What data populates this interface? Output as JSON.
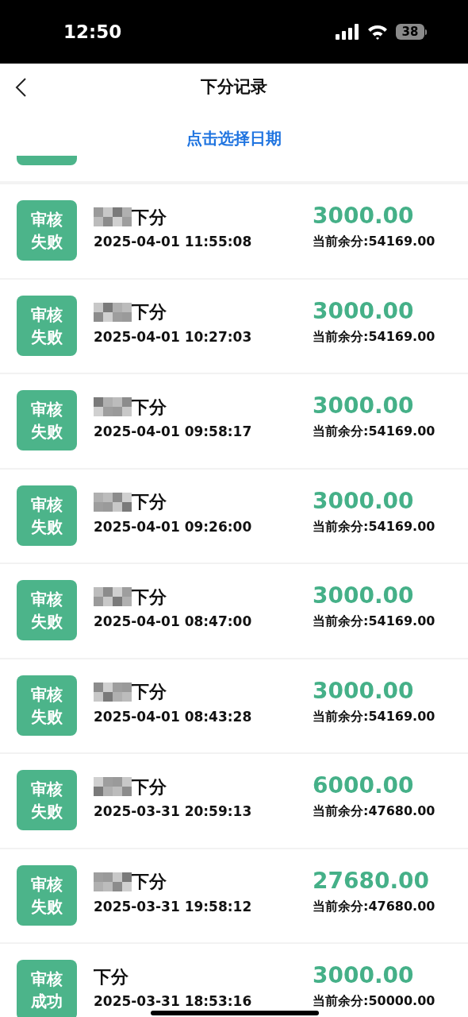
{
  "status_bar": {
    "time": "12:50",
    "battery": "38"
  },
  "header": {
    "title": "下分记录"
  },
  "date_picker": {
    "label": "点击选择日期"
  },
  "records": [
    {
      "status": "审核失败",
      "redacted": true,
      "title": "下分",
      "time": "2025-04-01 11:55:08",
      "amount": "3000.00",
      "balance": "当前余分:54169.00"
    },
    {
      "status": "审核失败",
      "redacted": true,
      "title": "下分",
      "time": "2025-04-01 10:27:03",
      "amount": "3000.00",
      "balance": "当前余分:54169.00"
    },
    {
      "status": "审核失败",
      "redacted": true,
      "title": "下分",
      "time": "2025-04-01 09:58:17",
      "amount": "3000.00",
      "balance": "当前余分:54169.00"
    },
    {
      "status": "审核失败",
      "redacted": true,
      "title": "下分",
      "time": "2025-04-01 09:26:00",
      "amount": "3000.00",
      "balance": "当前余分:54169.00"
    },
    {
      "status": "审核失败",
      "redacted": true,
      "title": "下分",
      "time": "2025-04-01 08:47:00",
      "amount": "3000.00",
      "balance": "当前余分:54169.00"
    },
    {
      "status": "审核失败",
      "redacted": true,
      "title": "下分",
      "time": "2025-04-01 08:43:28",
      "amount": "3000.00",
      "balance": "当前余分:54169.00"
    },
    {
      "status": "审核失败",
      "redacted": true,
      "title": "下分",
      "time": "2025-03-31 20:59:13",
      "amount": "6000.00",
      "balance": "当前余分:47680.00"
    },
    {
      "status": "审核失败",
      "redacted": true,
      "title": "下分",
      "time": "2025-03-31 19:58:12",
      "amount": "27680.00",
      "balance": "当前余分:47680.00"
    },
    {
      "status": "审核成功",
      "redacted": false,
      "title": "下分",
      "time": "2025-03-31 18:53:16",
      "amount": "3000.00",
      "balance": "当前余分:50000.00"
    }
  ]
}
